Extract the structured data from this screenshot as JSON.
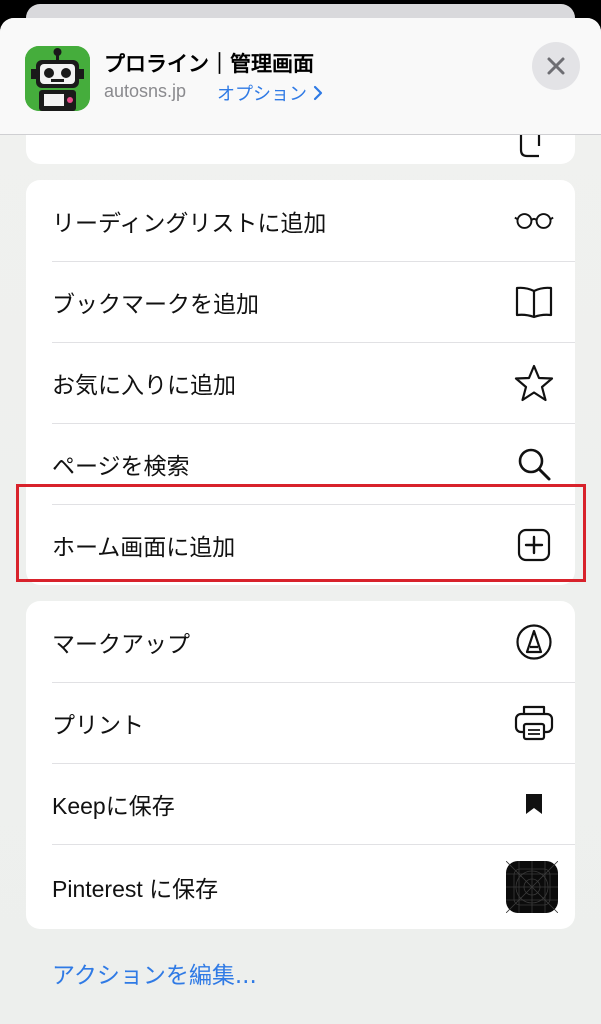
{
  "header": {
    "title": "プロライン｜管理画面",
    "domain": "autosns.jp",
    "options_label": "オプション",
    "app_icon": "robot-logo",
    "close_icon": "close-icon"
  },
  "group1": [
    {
      "label": "リーディングリストに追加",
      "icon": "glasses-icon"
    },
    {
      "label": "ブックマークを追加",
      "icon": "book-icon"
    },
    {
      "label": "お気に入りに追加",
      "icon": "star-icon"
    },
    {
      "label": "ページを検索",
      "icon": "search-icon"
    },
    {
      "label": "ホーム画面に追加",
      "icon": "plus-square-icon",
      "highlighted": true
    }
  ],
  "group2": [
    {
      "label": "マークアップ",
      "icon": "markup-pen-icon"
    },
    {
      "label": "プリント",
      "icon": "printer-icon"
    },
    {
      "label": "Keepに保存",
      "icon": "bookmark-icon"
    },
    {
      "label": "Pinterest に保存",
      "icon": "pinterest-app-icon"
    }
  ],
  "footer": {
    "edit_actions_label": "アクションを編集..."
  },
  "colors": {
    "accent": "#2f7ae5",
    "highlight_border": "#d8222b",
    "app_icon_green": "#3fa83a"
  }
}
